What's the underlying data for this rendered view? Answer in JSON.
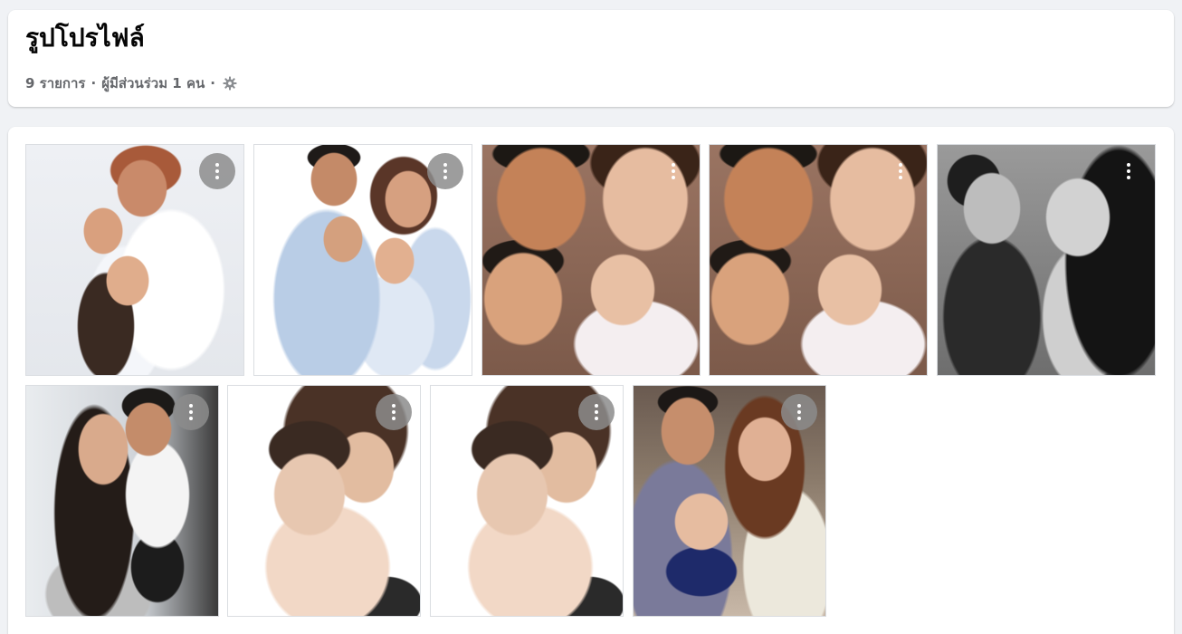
{
  "album": {
    "title": "รูปโปรไฟล์",
    "item_count": "9 รายการ",
    "separator": "·",
    "contributors": "ผู้มีส่วนร่วม 1 คน",
    "settings_icon": "gear-icon"
  },
  "photos": [
    {
      "name": "photo-1",
      "alt": "Mother hugging son and daughter in white shirts",
      "menu_icon": "more-vertical-icon"
    },
    {
      "name": "photo-2",
      "alt": "Family portrait with father, mother, son and daughter",
      "menu_icon": "more-vertical-icon"
    },
    {
      "name": "photo-3",
      "alt": "Selfie of family with newborn baby",
      "menu_icon": "more-vertical-icon"
    },
    {
      "name": "photo-4",
      "alt": "Selfie of family with newborn baby",
      "menu_icon": "more-vertical-icon"
    },
    {
      "name": "photo-5",
      "alt": "Black and white photo of mother and son",
      "menu_icon": "more-vertical-icon"
    },
    {
      "name": "photo-6",
      "alt": "Mother kissing son on balcony",
      "menu_icon": "more-vertical-icon"
    },
    {
      "name": "photo-7",
      "alt": "Mother holding baby boy",
      "menu_icon": "more-vertical-icon"
    },
    {
      "name": "photo-8",
      "alt": "Mother holding baby boy",
      "menu_icon": "more-vertical-icon"
    },
    {
      "name": "photo-9",
      "alt": "Couple holding baby in mall",
      "menu_icon": "more-vertical-icon"
    }
  ],
  "colors": {
    "background": "#f0f2f5",
    "card": "#ffffff",
    "title_text": "#050505",
    "meta_text": "#65676b",
    "menu_button": "#8c8c8c"
  }
}
